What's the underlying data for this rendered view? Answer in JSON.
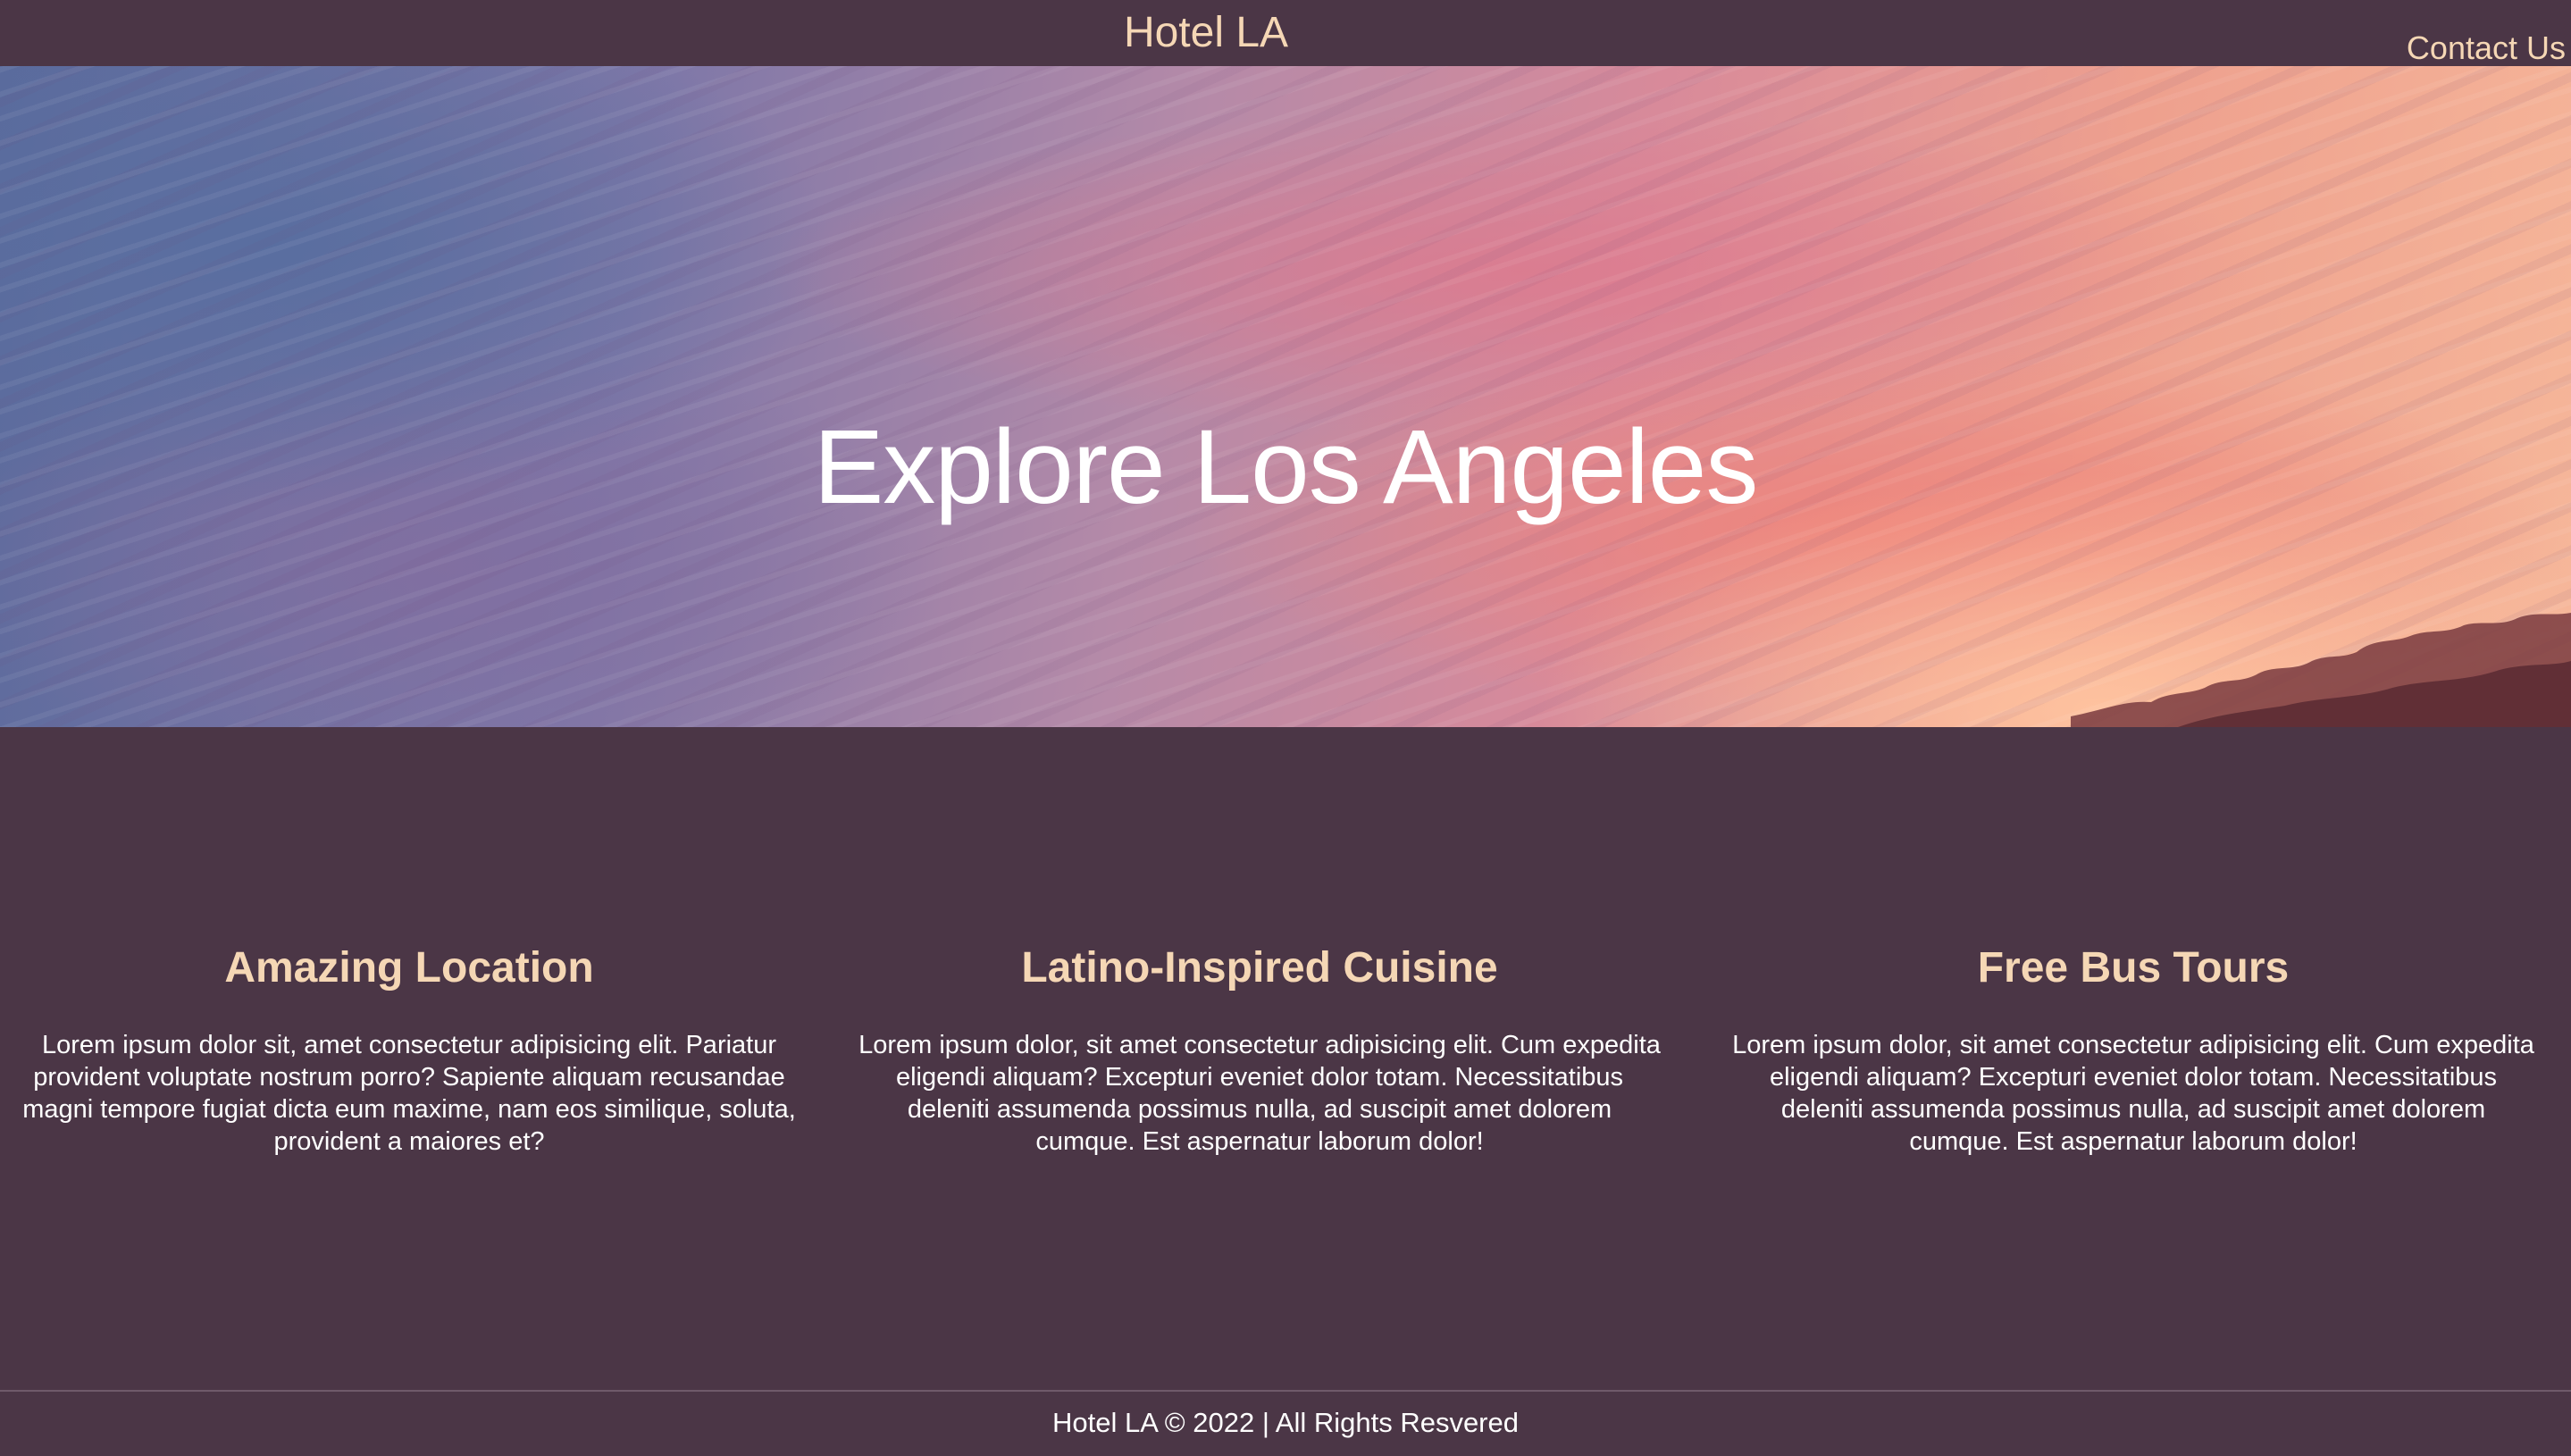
{
  "header": {
    "brand": "Hotel LA",
    "contact_label": "Contact Us"
  },
  "hero": {
    "title": "Explore Los Angeles"
  },
  "features": [
    {
      "title": "Amazing Location",
      "text": "Lorem ipsum dolor sit, amet consectetur adipisicing elit. Pariatur provident voluptate nostrum porro? Sapiente aliquam recusandae magni tempore fugiat dicta eum maxime, nam eos similique, soluta, provident a maiores et?"
    },
    {
      "title": "Latino-Inspired Cuisine",
      "text": "Lorem ipsum dolor, sit amet consectetur adipisicing elit. Cum expedita eligendi aliquam? Excepturi eveniet dolor totam. Necessitatibus deleniti assumenda possimus nulla, ad suscipit amet dolorem cumque. Est aspernatur laborum dolor!"
    },
    {
      "title": "Free Bus Tours",
      "text": "Lorem ipsum dolor, sit amet consectetur adipisicing elit. Cum expedita eligendi aliquam? Excepturi eveniet dolor totam. Necessitatibus deleniti assumenda possimus nulla, ad suscipit amet dolorem cumque. Est aspernatur laborum dolor!"
    }
  ],
  "footer": {
    "text": "Hotel LA © 2022  |  All Rights Resvered"
  },
  "colors": {
    "background": "#4b3646",
    "accent": "#f5d7b5",
    "text": "#ffffff"
  }
}
